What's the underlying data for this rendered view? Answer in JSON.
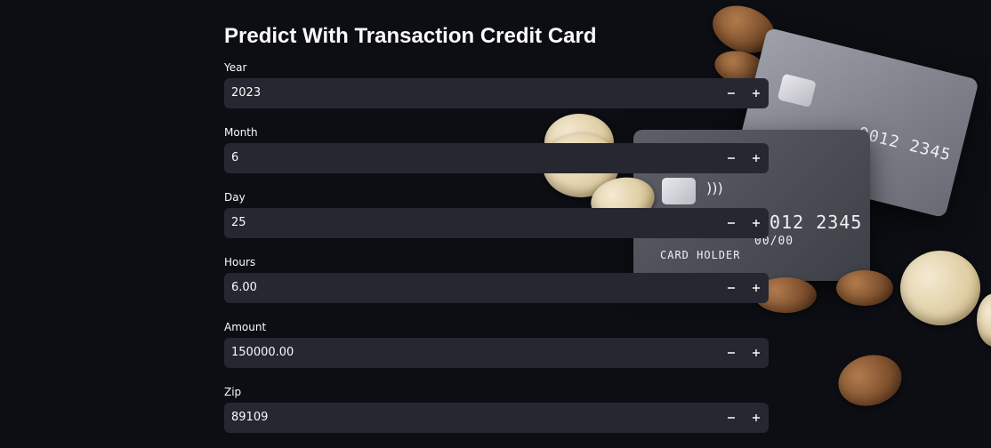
{
  "page": {
    "title": "Predict With Transaction Credit Card"
  },
  "fields": [
    {
      "label": "Year",
      "value": "2023"
    },
    {
      "label": "Month",
      "value": "6"
    },
    {
      "label": "Day",
      "value": "25"
    },
    {
      "label": "Hours",
      "value": "6.00"
    },
    {
      "label": "Amount",
      "value": "150000.00"
    },
    {
      "label": "Zip",
      "value": "89109"
    }
  ],
  "background": {
    "front_card": {
      "number": "9012 2345",
      "expiry": "00/00",
      "holder": "CARD HOLDER"
    },
    "back_card": {
      "number": "9012 2345"
    }
  },
  "colors": {
    "page_bg": "#0c0e13",
    "input_bg": "#262730",
    "text": "#fafafa"
  }
}
